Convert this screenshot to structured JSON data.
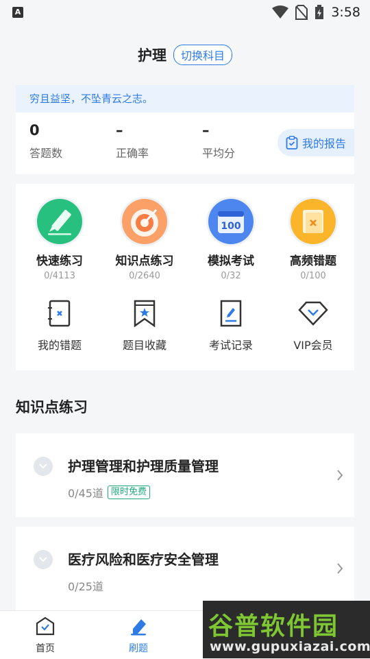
{
  "status_bar": {
    "time": "3:58",
    "app_badge": "A"
  },
  "header": {
    "subject": "护理",
    "switch_label": "切换科目"
  },
  "summary": {
    "motto": "穷且益坚，不坠青云之志。",
    "stats": [
      {
        "value": "0",
        "label": "答题数"
      },
      {
        "value": "–",
        "label": "正确率"
      },
      {
        "value": "–",
        "label": "平均分"
      }
    ],
    "report_label": "我的报告"
  },
  "features": [
    {
      "label": "快速练习",
      "count": "0/4113",
      "icon": "pencil-icon"
    },
    {
      "label": "知识点练习",
      "count": "0/2640",
      "icon": "target-icon"
    },
    {
      "label": "模拟考试",
      "count": "0/32",
      "icon": "calendar-100-icon"
    },
    {
      "label": "高频错题",
      "count": "0/100",
      "icon": "wrong-book-icon"
    }
  ],
  "tools": [
    {
      "label": "我的错题",
      "icon": "wrong-note-icon"
    },
    {
      "label": "题目收藏",
      "icon": "bookmark-icon"
    },
    {
      "label": "考试记录",
      "icon": "exam-record-icon"
    },
    {
      "label": "VIP会员",
      "icon": "diamond-icon"
    }
  ],
  "section_title": "知识点练习",
  "chapters": [
    {
      "title": "护理管理和护理质量管理",
      "progress": "0/45道",
      "badge": "限时免费"
    },
    {
      "title": "医疗风险和医疗安全管理",
      "progress": "0/25道"
    }
  ],
  "tabs": [
    {
      "label": "首页",
      "icon": "home-icon"
    },
    {
      "label": "刷题",
      "icon": "practice-icon",
      "active": true
    }
  ],
  "watermark": {
    "name": "谷普软件园",
    "url": "www.gupuxiazai.com"
  },
  "colors": {
    "accent": "#2f7be6",
    "free_green": "#1fa97a"
  }
}
